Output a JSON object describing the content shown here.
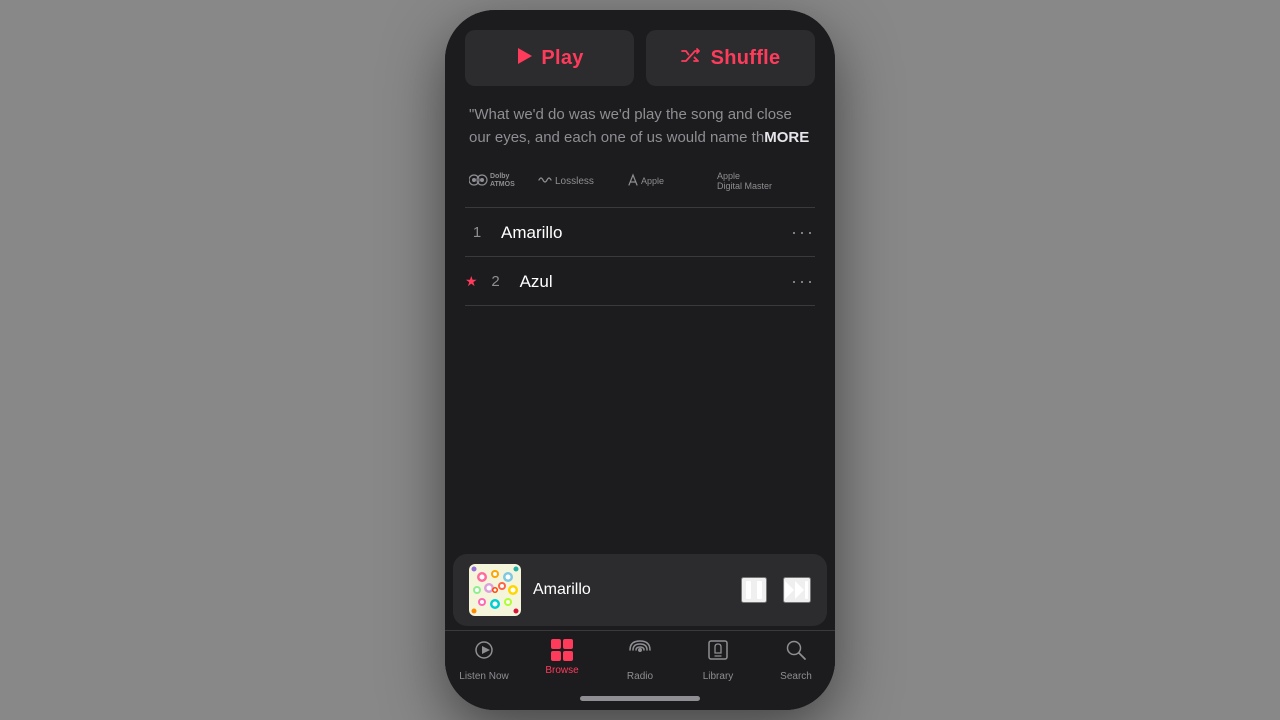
{
  "buttons": {
    "play_label": "Play",
    "shuffle_label": "Shuffle"
  },
  "quote": {
    "text": "\"What we'd do was we'd play the song and close our eyes, and each one of us would name th",
    "more_label": "MORE"
  },
  "badges": {
    "dolby": "Dolby ATMOS",
    "lossless": "Lossless",
    "adm": "Apple Digital Master"
  },
  "tracks": [
    {
      "num": "1",
      "star": false,
      "name": "Amarillo"
    },
    {
      "num": "2",
      "star": true,
      "name": "Azul"
    }
  ],
  "mini_player": {
    "track_name": "Amarillo"
  },
  "tabs": [
    {
      "id": "listen-now",
      "label": "Listen Now",
      "active": false
    },
    {
      "id": "browse",
      "label": "Browse",
      "active": true
    },
    {
      "id": "radio",
      "label": "Radio",
      "active": false
    },
    {
      "id": "library",
      "label": "Library",
      "active": false
    },
    {
      "id": "search",
      "label": "Search",
      "active": false
    }
  ],
  "colors": {
    "accent": "#ff3b5c",
    "background": "#1c1c1e",
    "surface": "#2c2c2e",
    "text_primary": "#ffffff",
    "text_secondary": "#8e8e93"
  }
}
